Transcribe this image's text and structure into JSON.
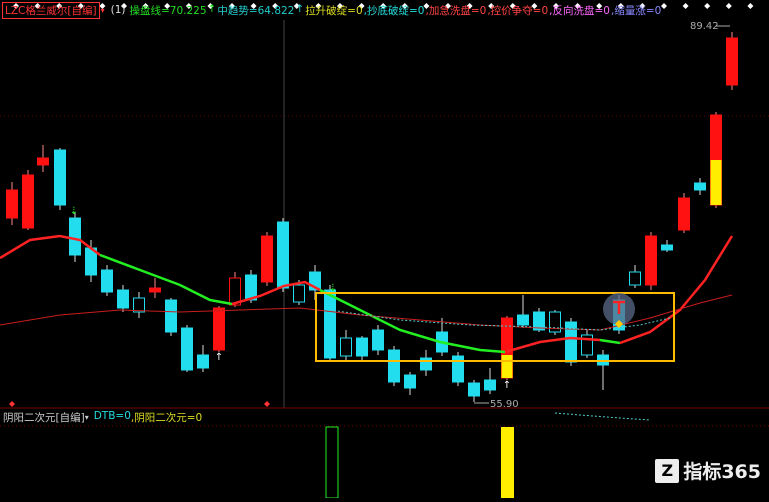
{
  "main_indicator": {
    "name": "LZC格兰威尔[自编]",
    "period": "(1)",
    "items": [
      {
        "label": "操盘线=70.225",
        "color": "#22dd22"
      },
      {
        "label": "↑",
        "color": "#22dd22"
      },
      {
        "label": "中趋势=64.822",
        "color": "#22cccc"
      },
      {
        "label": "↑",
        "color": "#22cccc"
      },
      {
        "label": "拉升破绽=0",
        "color": "#dddd22"
      },
      {
        "label": ",抄底破绽=0",
        "color": "#22dddd"
      },
      {
        "label": ",加急洗盘=0",
        "color": "#ff4444"
      },
      {
        "label": ",控价争夺=0",
        "color": "#ff4444"
      },
      {
        "label": ",反向洗盘=0",
        "color": "#ff66ff"
      },
      {
        "label": ",缩量涨=0",
        "color": "#8888ff"
      }
    ]
  },
  "price_labels": {
    "high": "89.42",
    "low": "55.90"
  },
  "sub_indicator": {
    "name": "阴阳二次元[自编]",
    "items": [
      {
        "label": "DTB=0",
        "color": "#22dddd"
      },
      {
        "label": ",阴阳二次元=0",
        "color": "#dddd22"
      }
    ]
  },
  "colors": {
    "up": "#ff1111",
    "down": "#22ddee",
    "fast_line_up": "#ff2222",
    "fast_line_down": "#22ee22",
    "slow_line": "#c81e1e",
    "box": "#ffbb00",
    "yellow": "#ffee00"
  },
  "icons": {
    "warning": "warning-diamond-icon",
    "logo": "zhibiao365-logo"
  },
  "logo": {
    "text": "指标365"
  }
}
